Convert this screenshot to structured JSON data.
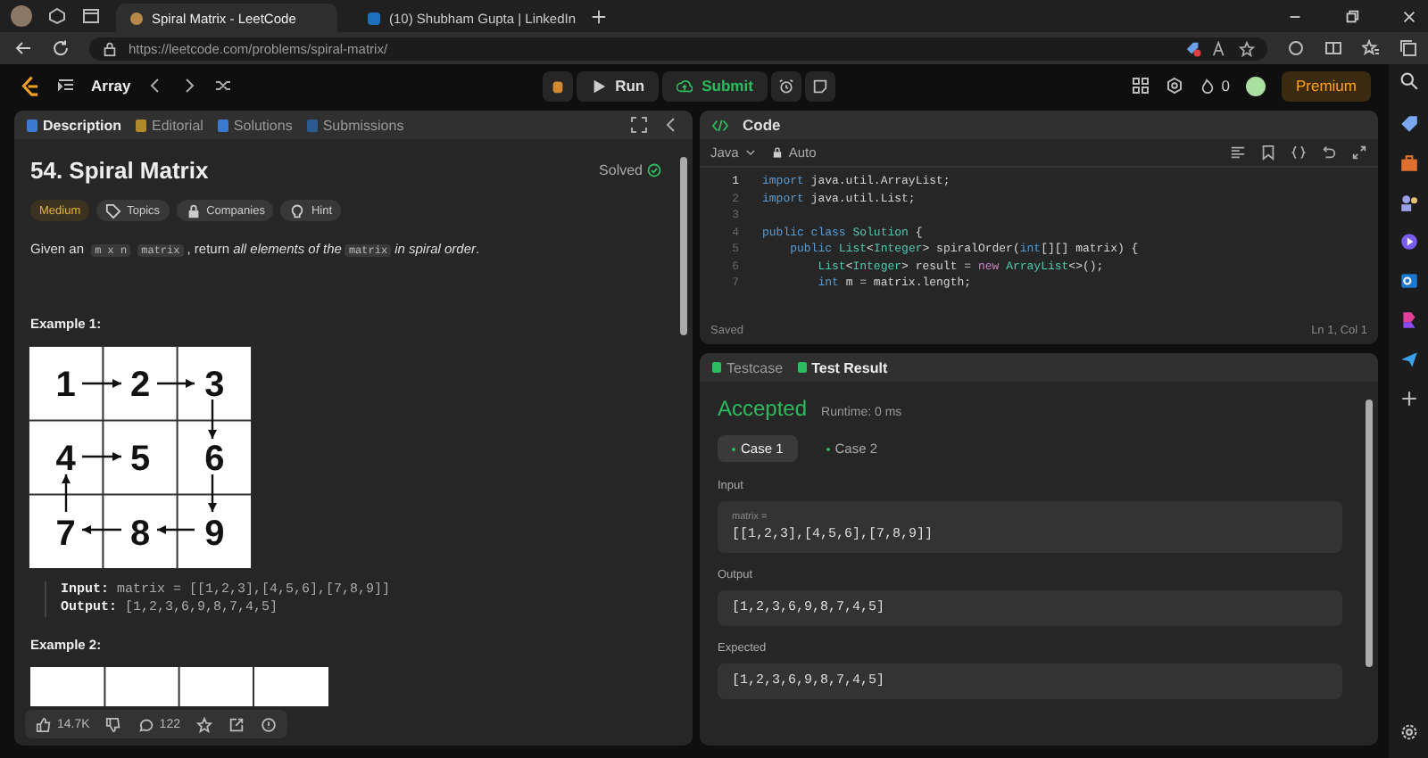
{
  "browser": {
    "tabs": [
      {
        "title": "Spiral Matrix - LeetCode",
        "selected": true
      },
      {
        "title": "(10) Shubham Gupta | LinkedIn",
        "selected": false
      }
    ],
    "url": "https://leetcode.com/problems/spiral-matrix/"
  },
  "nav": {
    "problem_list": "Array",
    "run": "Run",
    "submit": "Submit",
    "streak": "0",
    "premium": "Premium"
  },
  "description_panel": {
    "tabs": [
      {
        "label": "Description",
        "selected": true
      },
      {
        "label": "Editorial",
        "selected": false
      },
      {
        "label": "Solutions",
        "selected": false
      },
      {
        "label": "Submissions",
        "selected": false
      }
    ],
    "title": "54. Spiral Matrix",
    "status": "Solved",
    "tags": [
      {
        "kind": "difficulty",
        "label": "Medium"
      },
      {
        "kind": "topics",
        "label": "Topics"
      },
      {
        "kind": "companies",
        "label": "Companies"
      },
      {
        "kind": "hint",
        "label": "Hint"
      }
    ],
    "statement": [
      {
        "kind": "text",
        "text": "Given an "
      },
      {
        "kind": "code",
        "text": "m x n"
      },
      {
        "kind": "code",
        "text": "matrix"
      },
      {
        "kind": "text",
        "text": ", return "
      },
      {
        "kind": "italic",
        "text": "all elements of the"
      },
      {
        "kind": "code",
        "text": "matrix"
      },
      {
        "kind": "italic",
        "text": "in spiral order"
      },
      {
        "kind": "text",
        "text": "."
      }
    ],
    "example_1": {
      "title": "Example 1:",
      "grid": [
        [
          "1",
          "2",
          "3"
        ],
        [
          "4",
          "5",
          "6"
        ],
        [
          "7",
          "8",
          "9"
        ]
      ],
      "input_label": "Input:",
      "input": "matrix = [[1,2,3],[4,5,6],[7,8,9]]",
      "output_label": "Output:",
      "output": "[1,2,3,6,9,8,7,4,5]"
    },
    "example_2": {
      "title": "Example 2:"
    },
    "footer": {
      "likes": "14.7K",
      "comments": "122"
    }
  },
  "code_panel": {
    "title": "Code",
    "language": "Java",
    "mode": "Auto",
    "lines": [
      {
        "number": "1",
        "active": true,
        "tokens": [
          {
            "kind": "keyword",
            "text": "import"
          },
          {
            "kind": "plain",
            "text": " java.util.ArrayList;"
          }
        ]
      },
      {
        "number": "2",
        "active": false,
        "tokens": [
          {
            "kind": "keyword",
            "text": "import"
          },
          {
            "kind": "plain",
            "text": " java.util.List;"
          }
        ]
      },
      {
        "number": "3",
        "active": false
      },
      {
        "number": "4",
        "active": false,
        "tokens": [
          {
            "kind": "keyword",
            "text": "public class "
          },
          {
            "kind": "type",
            "text": "Solution"
          },
          {
            "kind": "plain",
            "text": " {"
          }
        ]
      },
      {
        "number": "5",
        "active": false,
        "tokens": [
          {
            "kind": "keyword",
            "text": "    public "
          },
          {
            "kind": "type",
            "text": "List"
          },
          {
            "kind": "plain",
            "text": "<"
          },
          {
            "kind": "type",
            "text": "Integer"
          },
          {
            "kind": "plain",
            "text": "> spiralOrder("
          },
          {
            "kind": "keyword",
            "text": "int"
          },
          {
            "kind": "plain",
            "text": "[][] matrix) {"
          }
        ]
      },
      {
        "number": "6",
        "active": false,
        "tokens": [
          {
            "kind": "type",
            "text": "        List"
          },
          {
            "kind": "plain",
            "text": "<"
          },
          {
            "kind": "type",
            "text": "Integer"
          },
          {
            "kind": "plain",
            "text": "> result = "
          },
          {
            "kind": "new",
            "text": "new "
          },
          {
            "kind": "type",
            "text": "ArrayList"
          },
          {
            "kind": "plain",
            "text": "<>();"
          }
        ]
      },
      {
        "number": "7",
        "active": false,
        "tokens": [
          {
            "kind": "keyword",
            "text": "        int"
          },
          {
            "kind": "plain",
            "text": " m = matrix.length;"
          }
        ]
      }
    ],
    "status": "Saved",
    "cursor": "Ln 1, Col 1"
  },
  "result_panel": {
    "tabs": [
      {
        "label": "Testcase",
        "selected": false
      },
      {
        "label": "Test Result",
        "selected": true
      }
    ],
    "verdict": "Accepted",
    "runtime": "Runtime: 0 ms",
    "cases": [
      {
        "label": "Case 1",
        "selected": true
      },
      {
        "label": "Case 2",
        "selected": false
      }
    ],
    "input_label": "Input",
    "param": "matrix =",
    "input": "[[1,2,3],[4,5,6],[7,8,9]]",
    "output_label": "Output",
    "output": "[1,2,3,6,9,8,7,4,5]",
    "expected_label": "Expected",
    "expected": "[1,2,3,6,9,8,7,4,5]"
  }
}
